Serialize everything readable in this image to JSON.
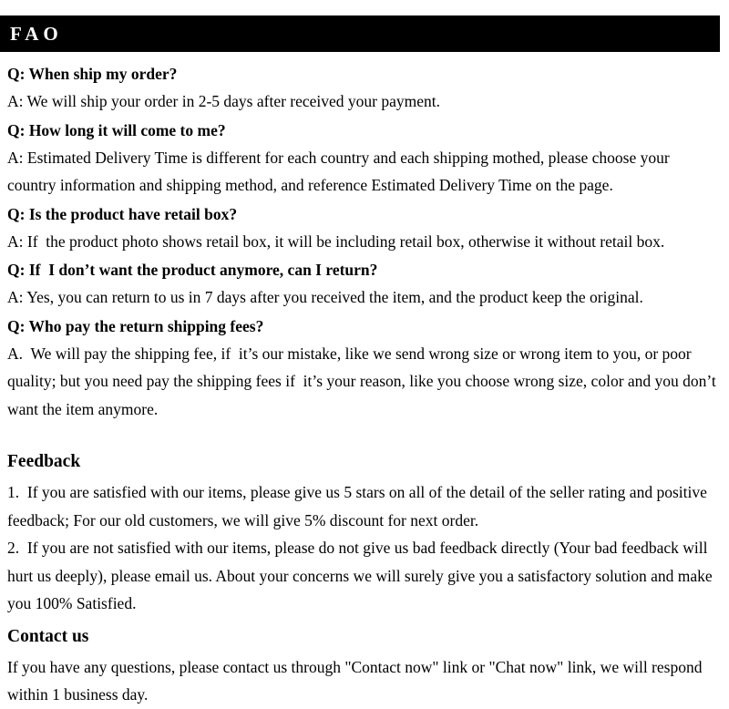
{
  "header": {
    "title": "FAO",
    "background_color": "#000000",
    "text_color": "#ffffff"
  },
  "faq": {
    "items": [
      {
        "question": "Q: When ship my order?",
        "answer": "A: We will ship your order in 2-5 days after received your payment."
      },
      {
        "question": "Q: How long it will come to me?",
        "answer": "A: Estimated Delivery Time is different for each country and each shipping mothed, please choose your country information and shipping method, and reference Estimated Delivery Time on the page."
      },
      {
        "question": "Q: Is the product have retail box?",
        "answer": "A: If  the product photo shows retail box, it will be including retail box, otherwise it without retail box."
      },
      {
        "question": "Q: If  I don’t want the product anymore, can I return?",
        "answer": "A: Yes, you can return to us in 7 days after you received the item, and the product keep the original."
      },
      {
        "question": "Q: Who pay the return shipping fees?",
        "answer": "A.  We will pay the shipping fee, if  it’s our mistake, like we send wrong size or wrong item to you, or poor quality; but you need pay the shipping fees if  it’s your reason, like you choose wrong size, color and you don’t want the item anymore."
      }
    ]
  },
  "feedback": {
    "heading": "Feedback",
    "item_1": "1.  If you are satisfied with our items, please give us 5 stars on all of the detail of the seller rating and positive feedback; For our old customers, we will give 5% discount for next order.",
    "item_2": "2.  If you are not satisfied with our items, please do not give us bad feedback directly (Your bad feedback will hurt us deeply), please email us. About your concerns we will surely give you a satisfactory solution and make you 100% Satisfied."
  },
  "contact": {
    "heading": "Contact us",
    "text": "If you have any questions, please contact us through \"Contact now\" link or \"Chat now\" link, we will respond within 1 business day."
  }
}
